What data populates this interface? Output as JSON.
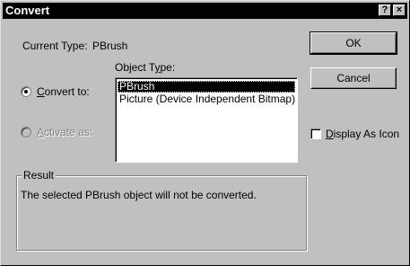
{
  "window": {
    "title": "Convert",
    "help_glyph": "?",
    "close_glyph": "×"
  },
  "current_type": {
    "label": "Current Type:",
    "value": "PBrush"
  },
  "object_type": {
    "label_prefix": "Object T",
    "label_mnemonic": "y",
    "label_suffix": "pe:",
    "items": [
      {
        "label": "PBrush",
        "selected": true
      },
      {
        "label": "Picture (Device Independent Bitmap)",
        "selected": false
      }
    ]
  },
  "options": {
    "convert": {
      "mnemonic": "C",
      "rest": "onvert to:",
      "checked": true,
      "enabled": true
    },
    "activate": {
      "mnemonic": "A",
      "rest": "ctivate as:",
      "checked": false,
      "enabled": false
    }
  },
  "buttons": {
    "ok": "OK",
    "cancel": "Cancel"
  },
  "display_as_icon": {
    "mnemonic": "D",
    "rest": "isplay As Icon",
    "checked": false
  },
  "result": {
    "title": "Result",
    "text": "The selected PBrush object will not be converted."
  },
  "colors": {
    "face": "#c0c0c0",
    "titlebar": "#000000",
    "selection": "#000000",
    "disabled_text": "#808080"
  }
}
